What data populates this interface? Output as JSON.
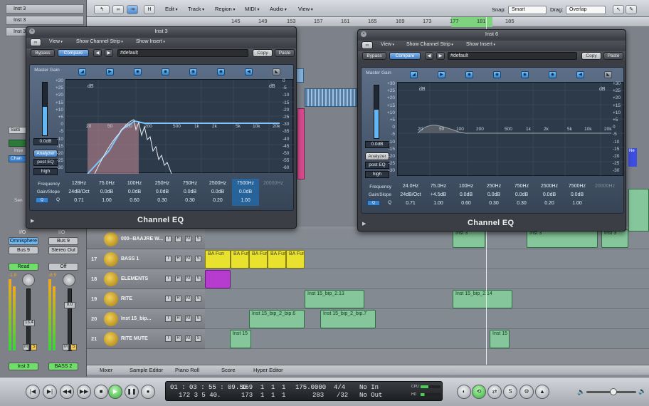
{
  "inspector": {
    "tracks": [
      "Inst 3",
      "Inst 3",
      "Inst 3"
    ],
    "settings_label": "Setti",
    "insert_label": "Inse",
    "chan_label": "Chan",
    "send_label": "Sen",
    "io_label1": "I/O",
    "io_label2": "I/O",
    "strip1": {
      "input": "Omnisphere",
      "output": "Bus 9",
      "auto": "Read",
      "value": "-1.8",
      "pan": "13.4",
      "m": "M",
      "s": "S",
      "name": "Inst 3"
    },
    "strip2": {
      "input": "Bus 9",
      "output": "Stereo Out",
      "auto": "Off",
      "value": "-8.5",
      "pan": "0.0",
      "m": "M",
      "s": "S",
      "name": "BASS 2"
    }
  },
  "toolbar": {
    "menus": [
      "Edit",
      "Track",
      "Region",
      "MIDI",
      "Audio",
      "View"
    ],
    "snap_label": "Snap:",
    "snap_value": "Smart",
    "drag_label": "Drag:",
    "drag_value": "Overlap",
    "h_label": "H"
  },
  "ruler": {
    "ticks": [
      "145",
      "149",
      "153",
      "157",
      "161",
      "165",
      "169",
      "173",
      "177",
      "181",
      "185"
    ]
  },
  "tracks": [
    {
      "num": "",
      "name": "000--BAAJRE W..."
    },
    {
      "num": "17",
      "name": "BASS 1"
    },
    {
      "num": "18",
      "name": "ELEMENTS"
    },
    {
      "num": "19",
      "name": "RITE"
    },
    {
      "num": "20",
      "name": "Inst 15_bip..."
    },
    {
      "num": "21",
      "name": "RITE MUTE"
    }
  ],
  "track_buttons": {
    "m": "M",
    "s": "S",
    "r": "R",
    "i": "I"
  },
  "regions": {
    "r16a": "Inst 3",
    "r16b": "Inst 3",
    "r16c": "Inst 3",
    "fun": "BA Fun",
    "r19a": "Inst 15_bip_2.13",
    "r19b": "Inst 15_bip_2.14",
    "r20a": "Inst 15_bip_2_bip.6",
    "r20b": "Inst 15_bip_2_bip.7",
    "r21a": "Inst 15",
    "r21b": "Inst 15",
    "side_label": "Ne"
  },
  "eq_left": {
    "title": "Inst 3",
    "menus": [
      "View",
      "Show Channel Strip",
      "Show Insert"
    ],
    "bypass": "Bypass",
    "compare": "Compare",
    "preset": "#default",
    "copy": "Copy",
    "paste": "Paste",
    "master_gain": "Master Gain",
    "master_value": "0.0dB",
    "analyzer": "Analyzer",
    "post_eq": "post EQ",
    "high": "high",
    "db_left": [
      "+30",
      "+25",
      "+20",
      "+15",
      "+10",
      "+5",
      "0",
      "-5",
      "-10",
      "-15",
      "-20",
      "-25",
      "-30"
    ],
    "db_right": [
      "0",
      "-5",
      "-10",
      "-15",
      "-20",
      "-25",
      "-30",
      "-35",
      "-40",
      "-45",
      "-50",
      "-55",
      "-60"
    ],
    "hz": [
      "20",
      "50",
      "100",
      "200",
      "500",
      "1k",
      "2k",
      "5k",
      "10k",
      "20k"
    ],
    "db_unit": "dB",
    "labels": {
      "freq": "Frequency",
      "gain": "Gain/Slope",
      "q": "Q",
      "link": "Q"
    },
    "bands": [
      {
        "f": "128Hz",
        "g": "24dB/Oct",
        "q": "0.71"
      },
      {
        "f": "75.0Hz",
        "g": "0.0dB",
        "q": "1.00"
      },
      {
        "f": "100Hz",
        "g": "0.0dB",
        "q": "0.60"
      },
      {
        "f": "250Hz",
        "g": "0.0dB",
        "q": "0.30"
      },
      {
        "f": "750Hz",
        "g": "0.0dB",
        "q": "0.30"
      },
      {
        "f": "2500Hz",
        "g": "0.0dB",
        "q": "0.20"
      },
      {
        "f": "7500Hz",
        "g": "0.0dB",
        "q": "1.00"
      },
      {
        "f": "20000Hz",
        "g": "",
        "q": ""
      }
    ],
    "name": "Channel EQ"
  },
  "eq_right": {
    "title": "Inst 6",
    "menus": [
      "View",
      "Show Channel Strip",
      "Show Insert"
    ],
    "bypass": "Bypass",
    "compare": "Compare",
    "preset": "#default",
    "copy": "Copy",
    "paste": "Paste",
    "master_gain": "Master Gain",
    "master_value": "0.0dB",
    "analyzer": "Analyzer",
    "post_eq": "post EQ",
    "high": "high",
    "db_left": [
      "+30",
      "+25",
      "+20",
      "+15",
      "+10",
      "+5",
      "0",
      "-5",
      "-10",
      "-15",
      "-20",
      "-25",
      "-30"
    ],
    "db_right": [
      "+30",
      "+25",
      "+20",
      "+15",
      "+10",
      "+5",
      "0",
      "-5",
      "-10",
      "-15",
      "-20",
      "-25",
      "-30"
    ],
    "hz": [
      "20",
      "50",
      "100",
      "200",
      "500",
      "1k",
      "2k",
      "5k",
      "10k",
      "20k"
    ],
    "db_unit": "dB",
    "labels": {
      "freq": "Frequency",
      "gain": "Gain/Slope",
      "q": "Q",
      "link": "Q"
    },
    "bands": [
      {
        "f": "24.0Hz",
        "g": "24dB/Oct",
        "q": "0.71"
      },
      {
        "f": "75.0Hz",
        "g": "+4.5dB",
        "q": "1.00"
      },
      {
        "f": "100Hz",
        "g": "0.0dB",
        "q": "0.60"
      },
      {
        "f": "250Hz",
        "g": "0.0dB",
        "q": "0.30"
      },
      {
        "f": "750Hz",
        "g": "0.0dB",
        "q": "0.30"
      },
      {
        "f": "2500Hz",
        "g": "0.0dB",
        "q": "0.20"
      },
      {
        "f": "7500Hz",
        "g": "0.0dB",
        "q": "1.00"
      },
      {
        "f": "20000Hz",
        "g": "",
        "q": ""
      }
    ],
    "name": "Channel EQ"
  },
  "bottom_tabs": [
    "Mixer",
    "Sample Editor",
    "Piano Roll",
    "Score",
    "Hyper Editor"
  ],
  "transport": {
    "smpte": "01 : 03 : 55 : 09.50",
    "smpte2": "172   3   5   40.",
    "bars1": [
      "169",
      "1",
      "1",
      "1"
    ],
    "bars2": [
      "173",
      "1",
      "1",
      "1"
    ],
    "tempo": "175.0000",
    "tempo2": "283",
    "sig": "4/4",
    "div": "/32",
    "in": "No In",
    "out": "No Out",
    "cpu": "CPU",
    "hd": "HD"
  }
}
